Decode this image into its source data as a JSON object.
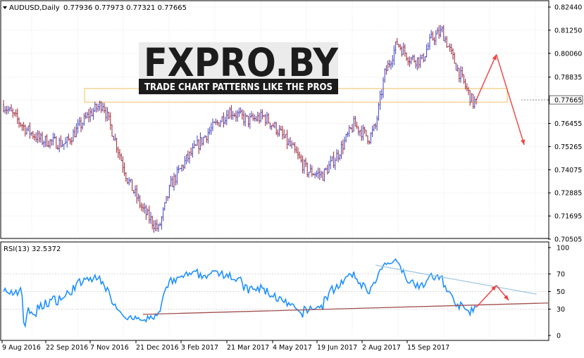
{
  "header": {
    "symbol": "AUDUSD,Daily",
    "ohlc": "0.77936 0.77973 0.77321 0.77665"
  },
  "watermark": {
    "brand": "FXPRO.BY",
    "tagline": "TRADE CHART PATTERNS LIKE THE PROS"
  },
  "rsi_header": "RSI(13) 32.5372",
  "colors": {
    "bull": "#4040c0",
    "bear": "#9a2030",
    "rsi_line": "#1e90ff",
    "support": "#a05050",
    "resistance": "#a0c8e0",
    "zone": "#f0c060",
    "arrow": "#f04040"
  },
  "chart_data": [
    {
      "type": "candlestick",
      "title": "AUDUSD,Daily",
      "ylim": [
        0.70505,
        0.8244
      ],
      "price_ticks": [
        "0.82440",
        "0.81250",
        "0.80060",
        "0.78835",
        "0.77665",
        "0.76455",
        "0.75265",
        "0.74075",
        "0.72885",
        "0.71695",
        "0.70505"
      ],
      "current_price_label": "0.77665",
      "date_labels": [
        "9 Aug 2016",
        "22 Sep 2016",
        "7 Nov 2016",
        "21 Dec 2016",
        "3 Feb 2017",
        "21 Mar 2017",
        "4 May 2017",
        "19 Jun 2017",
        "2 Aug 2017",
        "15 Sep 2017"
      ],
      "trend_knots": [
        [
          0,
          0.774
        ],
        [
          14,
          0.762
        ],
        [
          24,
          0.756
        ],
        [
          40,
          0.754
        ],
        [
          55,
          0.769
        ],
        [
          64,
          0.775
        ],
        [
          72,
          0.756
        ],
        [
          80,
          0.736
        ],
        [
          90,
          0.72
        ],
        [
          100,
          0.71
        ],
        [
          108,
          0.733
        ],
        [
          118,
          0.746
        ],
        [
          132,
          0.76
        ],
        [
          146,
          0.771
        ],
        [
          158,
          0.766
        ],
        [
          168,
          0.768
        ],
        [
          176,
          0.762
        ],
        [
          186,
          0.752
        ],
        [
          196,
          0.74
        ],
        [
          206,
          0.738
        ],
        [
          216,
          0.749
        ],
        [
          226,
          0.764
        ],
        [
          236,
          0.757
        ],
        [
          240,
          0.763
        ],
        [
          246,
          0.79
        ],
        [
          254,
          0.806
        ],
        [
          262,
          0.798
        ],
        [
          270,
          0.797
        ],
        [
          276,
          0.808
        ],
        [
          283,
          0.812
        ],
        [
          290,
          0.798
        ],
        [
          296,
          0.787
        ],
        [
          303,
          0.775
        ],
        [
          305,
          0.7766
        ]
      ],
      "support_resistance_zone": [
        0.7755,
        0.7825
      ],
      "forecast_arrows": [
        {
          "from": [
            305,
            0.7766
          ],
          "to": [
            318,
            0.8
          ]
        },
        {
          "from": [
            318,
            0.8
          ],
          "to": [
            336,
            0.7535
          ]
        }
      ]
    },
    {
      "type": "line",
      "title": "RSI(13) 32.5372",
      "ylim": [
        0,
        100
      ],
      "y_ticks": [
        "100",
        "70",
        "50",
        "30",
        "0"
      ],
      "level_lines": [
        70,
        50,
        30
      ],
      "current_value": 32.5372,
      "trendlines": [
        {
          "name": "support",
          "from": [
            90,
            24
          ],
          "to": [
            352,
            37
          ]
        },
        {
          "name": "resistance",
          "from": [
            240,
            80
          ],
          "to": [
            344,
            47
          ]
        }
      ],
      "forecast_arrows": [
        {
          "from": [
            305,
            32
          ],
          "to": [
            318,
            57
          ]
        },
        {
          "from": [
            318,
            57
          ],
          "to": [
            326,
            40
          ]
        }
      ]
    }
  ]
}
